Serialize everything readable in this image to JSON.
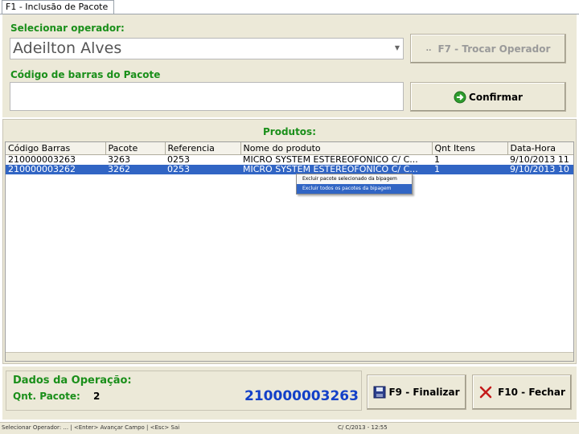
{
  "tab": {
    "label": "F1 - Inclusão de Pacote"
  },
  "operator": {
    "label": "Selecionar operador:",
    "value": "Adeilton Alves",
    "switch_button": "F7 - Trocar Operador",
    "switch_prefix": ".."
  },
  "barcode": {
    "label": "Código de barras do Pacote",
    "value": "",
    "confirm_button": "Confirmar"
  },
  "products": {
    "title": "Produtos:",
    "columns": [
      "Código Barras",
      "Pacote",
      "Referencia",
      "Nome do produto",
      "Qnt Itens",
      "Data-Hora"
    ],
    "rows": [
      [
        "210000003263",
        "3263",
        "0253",
        "MICRO SYSTEM ESTEREOFONICO C/ C...",
        "1",
        "9/10/2013 11"
      ],
      [
        "210000003262",
        "3262",
        "0253",
        "MICRO SYSTEM ESTEREOFONICO C/ C...",
        "1",
        "9/10/2013 10"
      ]
    ]
  },
  "context_menu": {
    "items": [
      "Excluir pacote selecionado da bipagem",
      "Excluir todos os pacotes da bipagem"
    ]
  },
  "operation": {
    "title": "Dados da Operação:",
    "qty_label": "Qnt. Pacote:",
    "qty_value": "2",
    "last_barcode": "210000003263"
  },
  "actions": {
    "finalize": "F9 - Finalizar",
    "close": "F10 - Fechar"
  },
  "status_bar": {
    "left": "Selecionar Operador: ... | <Enter> Avançar Campo | <Esc> Sai",
    "right": "C/ C/2013 - 12:55"
  },
  "colors": {
    "label_green": "#1a8f1a",
    "selection_blue": "#3165c4",
    "number_blue": "#1340c8",
    "panel_bg": "#ece9d8"
  }
}
